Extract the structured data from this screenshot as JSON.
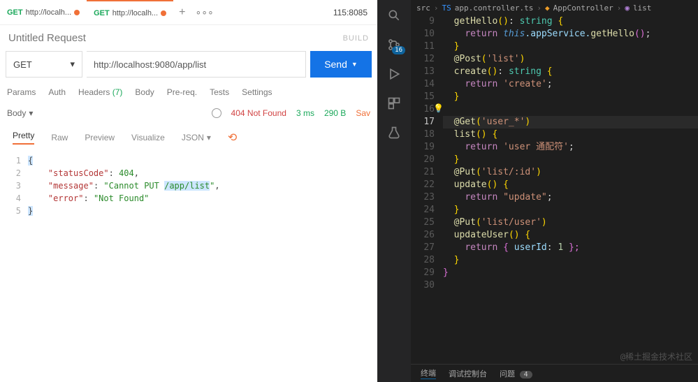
{
  "postman": {
    "tabs": [
      {
        "method": "GET",
        "label": "http://localh..."
      },
      {
        "method": "GET",
        "label": "http://localh..."
      }
    ],
    "server": "115:8085",
    "request_title": "Untitled Request",
    "build_label": "BUILD",
    "method": "GET",
    "url": "http://localhost:9080/app/list",
    "send": "Send",
    "req_tabs": {
      "params": "Params",
      "auth": "Auth",
      "headers": "Headers",
      "headers_count": "(7)",
      "body": "Body",
      "prereq": "Pre-req.",
      "tests": "Tests",
      "settings": "Settings"
    },
    "resp": {
      "body_label": "Body",
      "status": "404 Not Found",
      "time": "3 ms",
      "size": "290 B",
      "save": "Sav"
    },
    "view_tabs": {
      "pretty": "Pretty",
      "raw": "Raw",
      "preview": "Preview",
      "visualize": "Visualize",
      "format": "JSON"
    },
    "response_json": {
      "k1": "\"statusCode\"",
      "v1": "404",
      "k2": "\"message\"",
      "v2a": "\"Cannot PUT ",
      "v2b": "/app/list",
      "v2c": "\"",
      "k3": "\"error\"",
      "v3": "\"Not Found\""
    },
    "line_nums": [
      "1",
      "2",
      "3",
      "4",
      "5"
    ]
  },
  "vscode": {
    "breadcrumbs": {
      "folder": "src",
      "file": "app.controller.ts",
      "class": "AppController",
      "method": "list"
    },
    "badge": "16",
    "lines_start": 9,
    "lines": [
      "9",
      "10",
      "11",
      "12",
      "13",
      "14",
      "15",
      "16",
      "17",
      "18",
      "19",
      "20",
      "21",
      "22",
      "23",
      "24",
      "25",
      "26",
      "27",
      "28",
      "29",
      "30"
    ],
    "current_line": "17",
    "code": {
      "l9_a": "getHello",
      "l9_b": "()",
      "l9_c": ": ",
      "l9_d": "string",
      "l9_e": " {",
      "l10_a": "return ",
      "l10_b": "this",
      "l10_c": ".appService.",
      "l10_d": "getHello",
      "l10_e": "()",
      "l11": "}",
      "l12_a": "@",
      "l12_b": "Post",
      "l12_c": "(",
      "l12_d": "'list'",
      "l12_e": ")",
      "l13_a": "create",
      "l13_b": "()",
      "l13_c": ": ",
      "l13_d": "string",
      "l13_e": " {",
      "l14_a": "return ",
      "l14_b": "'create'",
      "l14_c": ";",
      "l15": "}",
      "l17_a": "@",
      "l17_b": "Get",
      "l17_c": "(",
      "l17_d": "'user_*'",
      "l17_e": ")",
      "l18_a": "list",
      "l18_b": "() {",
      "l19_a": "return ",
      "l19_b": "'user 通配符'",
      "l19_c": ";",
      "l20": "}",
      "l21_a": "@",
      "l21_b": "Put",
      "l21_c": "(",
      "l21_d": "'list/:id'",
      "l21_e": ")",
      "l22_a": "update",
      "l22_b": "() {",
      "l23_a": "return ",
      "l23_b": "\"update\"",
      "l23_c": ";",
      "l24": "}",
      "l25_a": "@",
      "l25_b": "Put",
      "l25_c": "(",
      "l25_d": "'list/user'",
      "l25_e": ")",
      "l26_a": "updateUser",
      "l26_b": "() {",
      "l27_a": "return ",
      "l27_b": "{ ",
      "l27_c": "userId",
      "l27_d": ": ",
      "l27_e": "1",
      "l27_f": " };",
      "l28": "}",
      "l29": "}"
    },
    "bottom_bar": {
      "terminal": "终端",
      "debug_console": "调试控制台",
      "problems": "问题",
      "problems_count": "4"
    },
    "watermark": "@稀土掘金技术社区"
  }
}
